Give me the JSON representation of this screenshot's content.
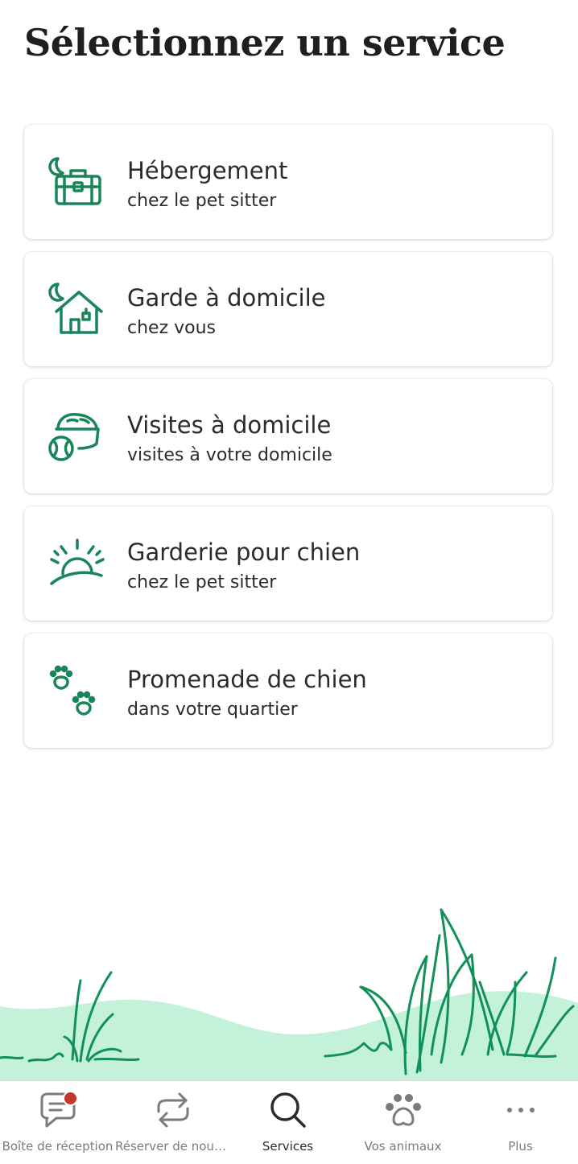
{
  "header": {
    "title": "Sélectionnez un service"
  },
  "services": [
    {
      "title": "Hébergement",
      "subtitle": "chez le pet sitter",
      "icon": "boarding-bag-icon"
    },
    {
      "title": "Garde à domicile",
      "subtitle": "chez vous",
      "icon": "house-sitting-icon"
    },
    {
      "title": "Visites à domicile",
      "subtitle": "visites à votre domicile",
      "icon": "food-bowl-icon"
    },
    {
      "title": "Garderie pour chien",
      "subtitle": "chez le pet sitter",
      "icon": "sunrise-icon"
    },
    {
      "title": "Promenade de chien",
      "subtitle": "dans votre quartier",
      "icon": "paw-prints-icon"
    }
  ],
  "tabbar": {
    "tabs": [
      {
        "label": "Boîte de réception",
        "icon": "chat-bubble-icon",
        "has_badge": true
      },
      {
        "label": "Réserver de nouv...",
        "icon": "repeat-icon"
      },
      {
        "label": "Services",
        "icon": "search-icon",
        "active": true
      },
      {
        "label": "Vos animaux",
        "icon": "paw-icon"
      },
      {
        "label": "Plus",
        "icon": "more-dots-icon"
      }
    ]
  },
  "colors": {
    "accent_green": "#18855a",
    "grass_light": "#c3f1da",
    "badge_red": "#c9352b"
  }
}
